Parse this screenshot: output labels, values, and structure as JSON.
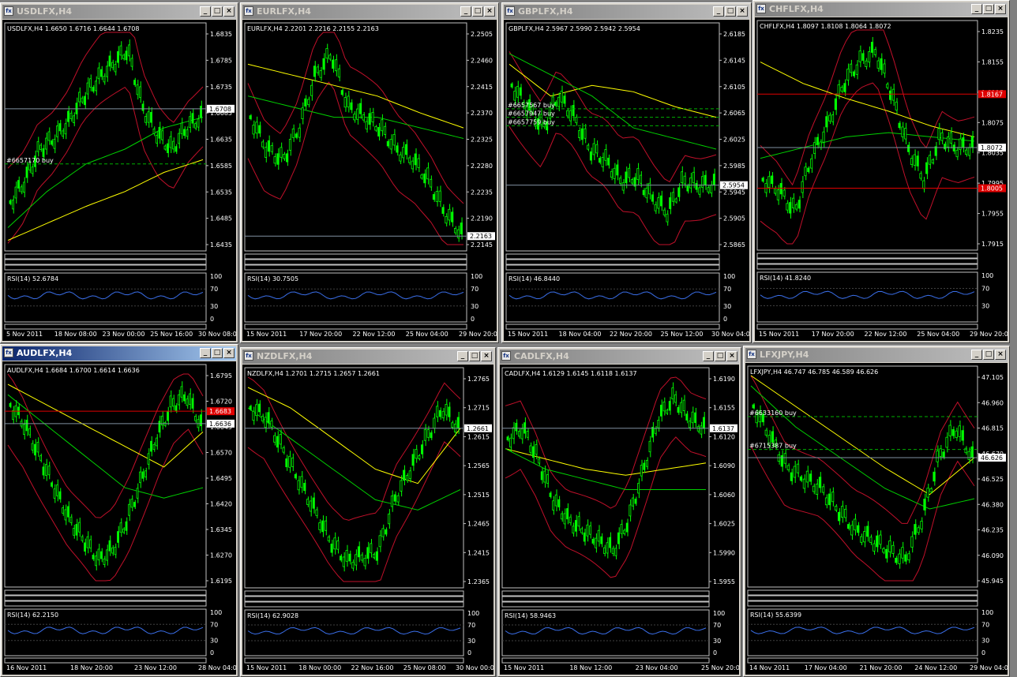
{
  "colors": {
    "candle": "#00ff00",
    "bands": "#c0102a",
    "ma_slow": "#ffff00",
    "ma_mid": "#00d000",
    "rsi": "#3a6ee8",
    "level": "#e00000",
    "order": "#00b000"
  },
  "windows": [
    {
      "title": "USDLFX,H4",
      "active": false,
      "info": "USDLFX,H4  1.6650 1.6716 1.6644 1.6708",
      "yticks": [
        "1.6835",
        "1.6785",
        "1.6735",
        "1.6685",
        "1.6635",
        "1.6585",
        "1.6535",
        "1.6485",
        "1.6435"
      ],
      "price_tag": "1.6708",
      "rsi_label": "RSI(14) 52.6784",
      "rsi_levels": [
        "100",
        "70",
        "30",
        "0"
      ],
      "xticks": [
        "5 Nov 2011",
        "18 Nov 08:00",
        "23 Nov 00:00",
        "25 Nov 16:00",
        "30 Nov 08:00"
      ],
      "orders": [
        "#6657170 buy"
      ],
      "level_tags": []
    },
    {
      "title": "EURLFX,H4",
      "active": false,
      "info": "EURLFX,H4  2.2201 2.2216 2.2155 2.2163",
      "yticks": [
        "2.2505",
        "2.2460",
        "2.2415",
        "2.2370",
        "2.2325",
        "2.2280",
        "2.2235",
        "2.2190",
        "2.2145"
      ],
      "price_tag": "2.2163",
      "rsi_label": "RSI(14) 30.7505",
      "rsi_levels": [
        "100",
        "70",
        "30",
        "0"
      ],
      "xticks": [
        "15 Nov 2011",
        "17 Nov 20:00",
        "22 Nov 12:00",
        "25 Nov 04:00",
        "29 Nov 20:00"
      ],
      "orders": [],
      "level_tags": []
    },
    {
      "title": "GBPLFX,H4",
      "active": false,
      "info": "GBPLFX,H4  2.5967 2.5990 2.5942 2.5954",
      "yticks": [
        "2.6185",
        "2.6145",
        "2.6105",
        "2.6065",
        "2.6025",
        "2.5985",
        "2.5945",
        "2.5905",
        "2.5865"
      ],
      "price_tag": "2.5954",
      "rsi_label": "RSI(14) 46.8440",
      "rsi_levels": [
        "100",
        "70",
        "30",
        "0"
      ],
      "xticks": [
        "15 Nov 2011",
        "18 Nov 04:00",
        "22 Nov 20:00",
        "25 Nov 12:00",
        "30 Nov 04:00"
      ],
      "orders": [
        "#6657567 buy",
        "#6657947 buy",
        "#6657759 buy"
      ],
      "level_tags": []
    },
    {
      "title": "CHFLFX,H4",
      "active": false,
      "info": "CHFLFX,H4  1.8097 1.8108 1.8064 1.8072",
      "yticks": [
        "1.8235",
        "1.8155",
        "1.8115",
        "1.8075",
        "1.8035",
        "1.7995",
        "1.7955",
        "1.7915"
      ],
      "price_tag": "1.8072",
      "rsi_label": "RSI(14) 41.8240",
      "rsi_levels": [
        "100",
        "70",
        "30"
      ],
      "xticks": [
        "15 Nov 2011",
        "17 Nov 20:00",
        "22 Nov 12:00",
        "25 Nov 04:00",
        "29 Nov 20:00"
      ],
      "orders": [],
      "level_tags": [
        "1.8167",
        "1.8005"
      ]
    },
    {
      "title": "AUDLFX,H4",
      "active": true,
      "info": "AUDLFX,H4  1.6684 1.6700 1.6614 1.6636",
      "yticks": [
        "1.6795",
        "1.6720",
        "1.6645",
        "1.6570",
        "1.6495",
        "1.6420",
        "1.6345",
        "1.6270",
        "1.6195"
      ],
      "price_tag": "1.6636",
      "rsi_label": "RSI(14) 62.2150",
      "rsi_levels": [
        "100",
        "70",
        "30",
        "0"
      ],
      "xticks": [
        "16 Nov 2011",
        "18 Nov 20:00",
        "23 Nov 12:00",
        "28 Nov 04:00"
      ],
      "orders": [],
      "level_tags": [
        "1.6683"
      ]
    },
    {
      "title": "NZDLFX,H4",
      "active": false,
      "info": "NZDLFX,H4  1.2701 1.2715 1.2657 1.2661",
      "yticks": [
        "1.2765",
        "1.2715",
        "1.2615",
        "1.2565",
        "1.2515",
        "1.2465",
        "1.2415",
        "1.2365"
      ],
      "price_tag": "1.2661",
      "rsi_label": "RSI(14) 62.9028",
      "rsi_levels": [
        "100",
        "70",
        "30",
        "0"
      ],
      "xticks": [
        "15 Nov 2011",
        "18 Nov 00:00",
        "22 Nov 16:00",
        "25 Nov 08:00",
        "30 Nov 00:00"
      ],
      "orders": [],
      "level_tags": []
    },
    {
      "title": "CADLFX,H4",
      "active": false,
      "info": "CADLFX,H4  1.6129 1.6145 1.6118 1.6137",
      "yticks": [
        "1.6190",
        "1.6155",
        "1.6120",
        "1.6090",
        "1.6060",
        "1.6025",
        "1.5990",
        "1.5955"
      ],
      "price_tag": "1.6137",
      "rsi_label": "RSI(14) 58.9463",
      "rsi_levels": [
        "100",
        "70",
        "30",
        "0"
      ],
      "xticks": [
        "15 Nov 2011",
        "18 Nov 12:00",
        "23 Nov 04:00",
        "25 Nov 20:00"
      ],
      "orders": [],
      "level_tags": []
    },
    {
      "title": "LFXJPY,H4",
      "active": false,
      "info": "LFXJPY,H4  46.747 46.785 46.589 46.626",
      "yticks": [
        "47.105",
        "46.960",
        "46.815",
        "46.670",
        "46.525",
        "46.380",
        "46.235",
        "46.090",
        "45.945"
      ],
      "price_tag": "46.626",
      "rsi_label": "RSI(14) 55.6399",
      "rsi_levels": [
        "100",
        "70",
        "30",
        "0"
      ],
      "xticks": [
        "14 Nov 2011",
        "17 Nov 04:00",
        "21 Nov 20:00",
        "24 Nov 12:00",
        "29 Nov 04:00"
      ],
      "orders": [
        "#6633160 buy",
        "#6715387 buy"
      ],
      "level_tags": []
    }
  ]
}
